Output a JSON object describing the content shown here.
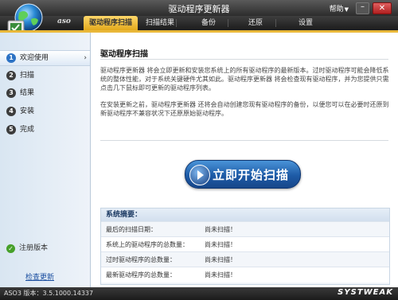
{
  "window": {
    "title": "驱动程序更新器",
    "help_label": "帮助",
    "minimize": "–",
    "close": "✕"
  },
  "brand": "aso",
  "tabs": [
    {
      "label": "驱动程序扫描",
      "active": true
    },
    {
      "label": "扫描结果",
      "active": false
    },
    {
      "label": "备份",
      "active": false
    },
    {
      "label": "还原",
      "active": false
    },
    {
      "label": "设置",
      "active": false
    }
  ],
  "sidebar": {
    "steps": [
      {
        "num": "1",
        "label": "欢迎使用",
        "active": true,
        "arrow": "›"
      },
      {
        "num": "2",
        "label": "扫描",
        "active": false
      },
      {
        "num": "3",
        "label": "结果",
        "active": false
      },
      {
        "num": "4",
        "label": "安装",
        "active": false
      },
      {
        "num": "5",
        "label": "完成",
        "active": false
      }
    ],
    "registered": "注册版本",
    "check_update": "检查更新"
  },
  "main": {
    "heading": "驱动程序扫描",
    "paragraph1": "驱动程序更新器 将会立即更新和安装您系统上的所有驱动程序的最新版本。过时驱动程序可能会降低系统的整体性能，对于系统关键硬件尤其如此。驱动程序更新器 将会检查现有驱动程序，并为您提供只需点击几下鼠标即可更新的驱动程序列表。",
    "paragraph2": "在安装更新之前，驱动程序更新器 还将会自动创建您现有驱动程序的备份，以便您可以在必要时还原到新驱动程序不兼容状况下还原原始驱动程序。",
    "scan_button": "立即开始扫描"
  },
  "summary": {
    "title": "系统摘要：",
    "rows": [
      {
        "label": "最后的扫描日期：",
        "value": "尚未扫描！"
      },
      {
        "label": "系统上的驱动程序的总数量：",
        "value": "尚未扫描！"
      },
      {
        "label": "过时驱动程序的总数量：",
        "value": "尚未扫描！"
      },
      {
        "label": "最新驱动程序的总数量：",
        "value": "尚未扫描！"
      }
    ]
  },
  "status": {
    "version": "ASO3 版本：3.5.1000.14337",
    "vendor": "SYSTWEAK"
  },
  "colors": {
    "active_tab": "#f2c14a",
    "accent_blue": "#1d5aa6",
    "sidebar_bg": "#dfe9f4"
  }
}
